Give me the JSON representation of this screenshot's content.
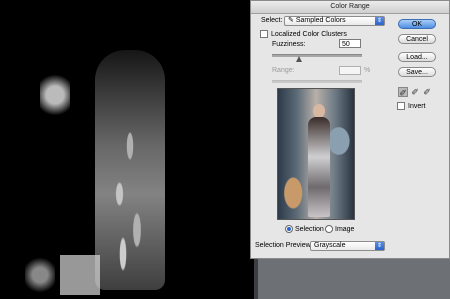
{
  "dialog": {
    "title": "Color Range",
    "select_label": "Select:",
    "select_value": "Sampled Colors",
    "localized_label": "Localized Color Clusters",
    "fuzziness_label": "Fuzziness:",
    "fuzziness_value": "50",
    "range_label": "Range:",
    "range_unit": "%",
    "radio_selection": "Selection",
    "radio_image": "Image",
    "selection_preview_label": "Selection Preview:",
    "selection_preview_value": "Grayscale",
    "invert_label": "Invert"
  },
  "buttons": {
    "ok": "OK",
    "cancel": "Cancel",
    "load": "Load...",
    "save": "Save..."
  },
  "colors": {
    "primary_button": "#4e8fe2",
    "dialog_bg": "#e6e6e6",
    "canvas_bg": "#000000"
  }
}
